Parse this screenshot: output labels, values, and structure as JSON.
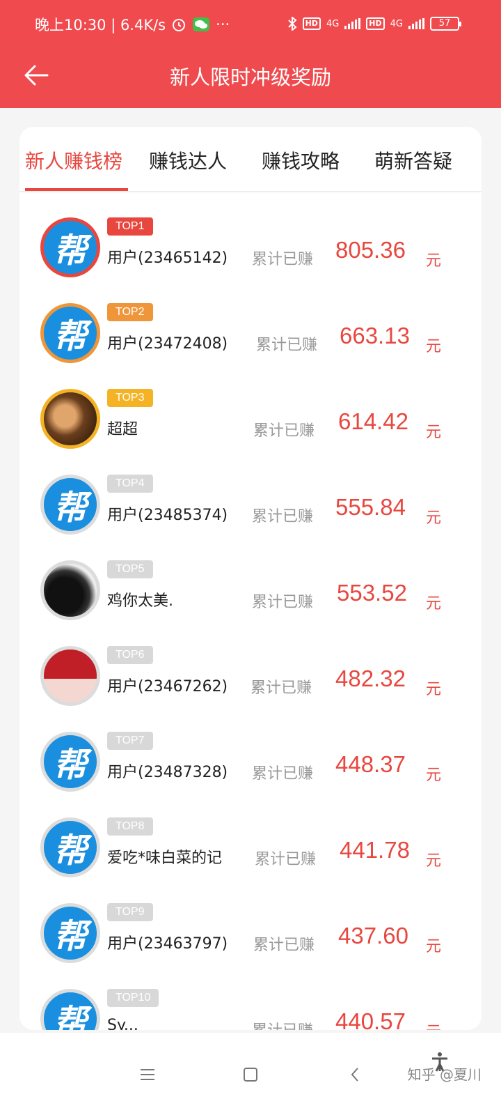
{
  "status_bar": {
    "time_text": "晚上10:30 | 6.4K/s",
    "icons": [
      "alarm-icon",
      "wechat-icon",
      "more-icon",
      "bluetooth-icon",
      "hd-icon",
      "signal-4g-icon",
      "hd-icon",
      "signal-4g-icon",
      "battery-icon"
    ],
    "more": "···",
    "hd1": "HD",
    "net1": "4G",
    "hd2": "HD",
    "net2": "4G",
    "battery": "57"
  },
  "header": {
    "title": "新人限时冲级奖励",
    "back_icon": "arrow-left-icon"
  },
  "tabs": [
    {
      "label": "新人赚钱榜",
      "active": true
    },
    {
      "label": "赚钱达人",
      "active": false
    },
    {
      "label": "赚钱攻略",
      "active": false
    },
    {
      "label": "萌新答疑",
      "active": false
    }
  ],
  "ranking": [
    {
      "rank": "TOP1",
      "name": "用户(23465142)",
      "earned_label": "累计已赚",
      "amount": "805.36",
      "unit": "元",
      "avatar": "帮"
    },
    {
      "rank": "TOP2",
      "name": "用户(23472408)",
      "earned_label": "累计已赚",
      "amount": "663.13",
      "unit": "元",
      "avatar": "帮"
    },
    {
      "rank": "TOP3",
      "name": "超超",
      "earned_label": "累计已赚",
      "amount": "614.42",
      "unit": "元",
      "avatar": ""
    },
    {
      "rank": "TOP4",
      "name": "用户(23485374)",
      "earned_label": "累计已赚",
      "amount": "555.84",
      "unit": "元",
      "avatar": "帮"
    },
    {
      "rank": "TOP5",
      "name": "鸡你太美.",
      "earned_label": "累计已赚",
      "amount": "553.52",
      "unit": "元",
      "avatar": ""
    },
    {
      "rank": "TOP6",
      "name": "用户(23467262)",
      "earned_label": "累计已赚",
      "amount": "482.32",
      "unit": "元",
      "avatar": ""
    },
    {
      "rank": "TOP7",
      "name": "用户(23487328)",
      "earned_label": "累计已赚",
      "amount": "448.37",
      "unit": "元",
      "avatar": "帮"
    },
    {
      "rank": "TOP8",
      "name": "爱吃*味白菜的记",
      "earned_label": "累计已赚",
      "amount": "441.78",
      "unit": "元",
      "avatar": "帮"
    },
    {
      "rank": "TOP9",
      "name": "用户(23463797)",
      "earned_label": "累计已赚",
      "amount": "437.60",
      "unit": "元",
      "avatar": "帮"
    },
    {
      "rank": "TOP10",
      "name": "Sy...",
      "earned_label": "累计已赚",
      "amount": "440.57",
      "unit": "元",
      "avatar": "帮"
    }
  ],
  "nav": {
    "icons": [
      "menu-icon",
      "home-icon",
      "back-icon",
      "accessibility-icon"
    ],
    "watermark": "知乎 @夏川"
  },
  "colors": {
    "brand_red": "#ef4b4f",
    "amount_red": "#e8473f",
    "top2_orange": "#f0963a",
    "top3_yellow": "#f4b324",
    "badge_gray": "#d8d8d8",
    "avatar_blue": "#1a8fe0"
  }
}
